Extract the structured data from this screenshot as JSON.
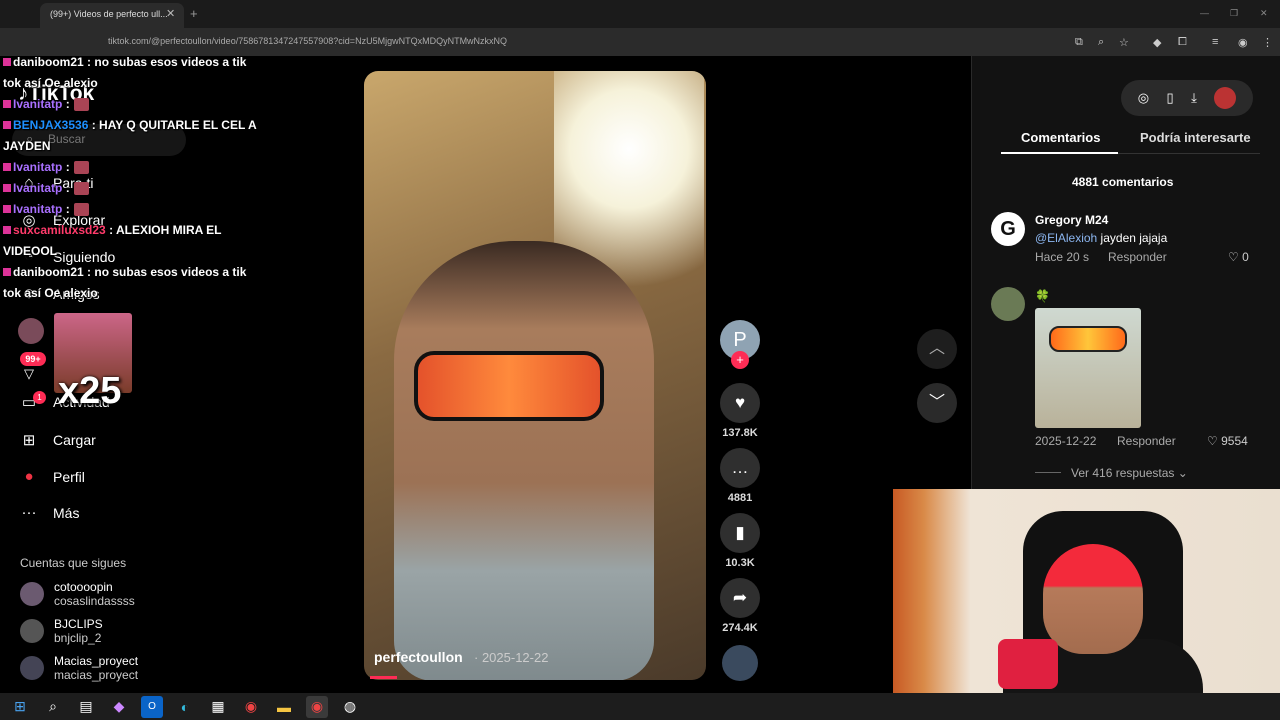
{
  "browser": {
    "tab_title": "(99+) Videos de perfecto ull...",
    "url": "tiktok.com/@perfectoullon/video/7586781347247557908?cid=NzU5MjgwNTQxMDQyNTMwNzkxNQ"
  },
  "sidebar": {
    "logo": "TikTok",
    "search_placeholder": "Buscar",
    "nav": [
      {
        "label": "Para ti",
        "icon": "home-icon"
      },
      {
        "label": "Explorar",
        "icon": "compass-icon"
      },
      {
        "label": "Siguiendo",
        "icon": "following-icon"
      },
      {
        "label": "Amigos",
        "icon": "friends-icon"
      },
      {
        "label": "Actividad",
        "icon": "inbox-icon"
      },
      {
        "label": "Cargar",
        "icon": "upload-icon"
      },
      {
        "label": "Perfil",
        "icon": "profile-icon"
      },
      {
        "label": "Más",
        "icon": "more-icon"
      }
    ],
    "badges": {
      "messages": "99+",
      "activity": "1"
    },
    "following_heading": "Cuentas que sigues",
    "following": [
      {
        "name": "cotoooopin",
        "handle": "cosaslindassss"
      },
      {
        "name": "BJCLIPS",
        "handle": "bnjclip_2"
      },
      {
        "name": "Macias_proyect",
        "handle": "macias_proyect"
      }
    ]
  },
  "chat": {
    "messages": [
      {
        "user": "daniboom21",
        "text": ": no subas esos videos a tik tok así Oe alexio",
        "color": "#ffffff"
      },
      {
        "user": "Ivanitatp",
        "text": ":",
        "color": "#a970ff"
      },
      {
        "user": "BENJAX3536",
        "text": ": HAY Q QUITARLE EL CEL A JAYDEN",
        "color": "#1e90ff"
      },
      {
        "user": "Ivanitatp",
        "text": ":",
        "color": "#a970ff"
      },
      {
        "user": "Ivanitatp",
        "text": ":",
        "color": "#a970ff"
      },
      {
        "user": "Ivanitatp",
        "text": ":",
        "color": "#a970ff"
      },
      {
        "user": "suxcamiluxsd23",
        "text": ": ALEXIOH MIRA EL VIDEOOL",
        "color": "#ff3b6b"
      },
      {
        "user": "daniboom21",
        "text": ": no subas esos videos a tik tok así Oe alexio",
        "color": "#ffffff"
      }
    ],
    "emote_count": "x25"
  },
  "video": {
    "author": "perfectoullon",
    "date": "· 2025-12-22",
    "author_avatar_letter": "P",
    "progress": 0.08,
    "actions": [
      {
        "icon": "heart-icon",
        "count": "137.8K"
      },
      {
        "icon": "comment-icon",
        "count": "4881"
      },
      {
        "icon": "bookmark-icon",
        "count": "10.3K"
      },
      {
        "icon": "share-icon",
        "count": "274.4K"
      }
    ]
  },
  "panel": {
    "tabs": [
      "Comentarios",
      "Podría interesarte"
    ],
    "count_label": "4881 comentarios",
    "comments": [
      {
        "author": "Gregory M24",
        "avatar_letter": "G",
        "mention": "@ElAlexioh",
        "text": " jayden jajaja",
        "time": "Hace 20 s",
        "reply": "Responder",
        "likes": "0"
      },
      {
        "author": "🍀",
        "time": "2025-12-22",
        "reply": "Responder",
        "likes": "9554",
        "replies_label": "Ver 416 respuestas"
      }
    ]
  },
  "colors": {
    "accent": "#fe2c55",
    "panel_bg": "#121212",
    "mention": "#8cb6f0"
  }
}
